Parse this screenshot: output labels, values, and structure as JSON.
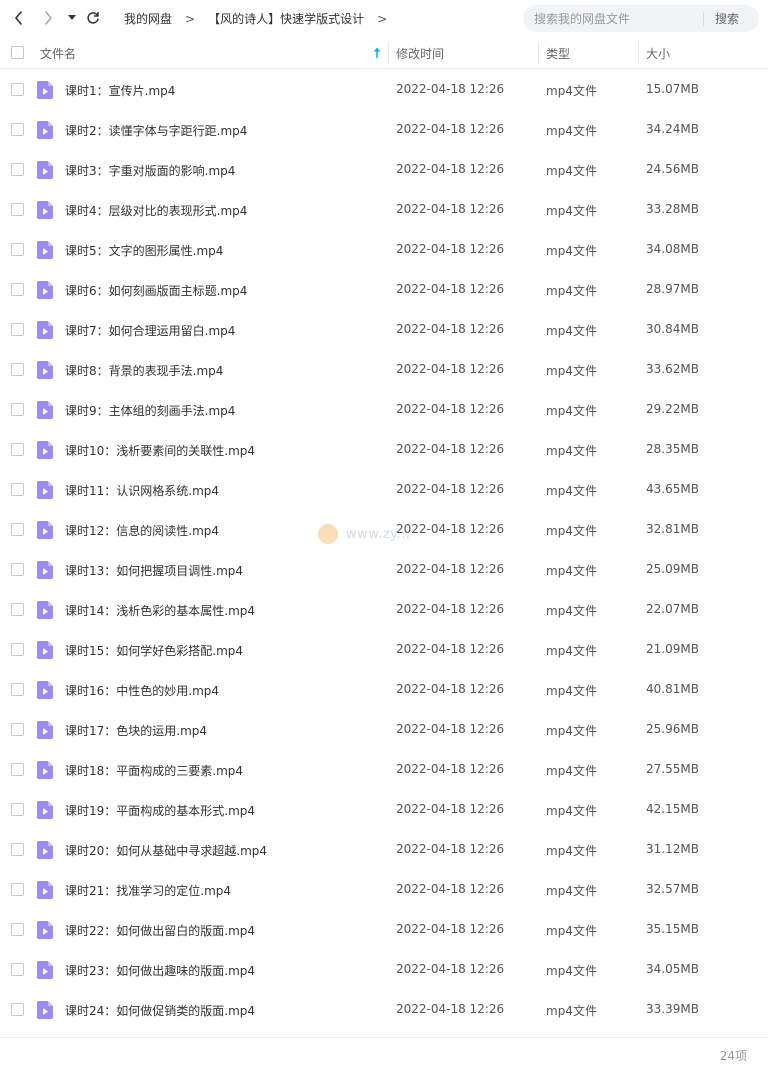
{
  "nav": {
    "back_icon": "chevron-left-icon",
    "forward_icon": "chevron-right-icon",
    "dropdown_icon": "caret-down-icon",
    "refresh_icon": "refresh-icon"
  },
  "breadcrumb": {
    "items": [
      "我的网盘",
      "【风的诗人】快速学版式设计"
    ],
    "separator": ">"
  },
  "search": {
    "placeholder": "搜索我的网盘文件",
    "button_label": "搜索"
  },
  "table": {
    "headers": {
      "name": "文件名",
      "modified": "修改时间",
      "type": "类型",
      "size": "大小"
    },
    "sort_indicator": "sort-ascending-icon",
    "rows": [
      {
        "name": "课时1：宣传片.mp4",
        "modified": "2022-04-18 12:26",
        "type": "mp4文件",
        "size": "15.07MB"
      },
      {
        "name": "课时2：读懂字体与字距行距.mp4",
        "modified": "2022-04-18 12:26",
        "type": "mp4文件",
        "size": "34.24MB"
      },
      {
        "name": "课时3：字重对版面的影响.mp4",
        "modified": "2022-04-18 12:26",
        "type": "mp4文件",
        "size": "24.56MB"
      },
      {
        "name": "课时4：层级对比的表现形式.mp4",
        "modified": "2022-04-18 12:26",
        "type": "mp4文件",
        "size": "33.28MB"
      },
      {
        "name": "课时5：文字的图形属性.mp4",
        "modified": "2022-04-18 12:26",
        "type": "mp4文件",
        "size": "34.08MB"
      },
      {
        "name": "课时6：如何刻画版面主标题.mp4",
        "modified": "2022-04-18 12:26",
        "type": "mp4文件",
        "size": "28.97MB"
      },
      {
        "name": "课时7：如何合理运用留白.mp4",
        "modified": "2022-04-18 12:26",
        "type": "mp4文件",
        "size": "30.84MB"
      },
      {
        "name": "课时8：背景的表现手法.mp4",
        "modified": "2022-04-18 12:26",
        "type": "mp4文件",
        "size": "33.62MB"
      },
      {
        "name": "课时9：主体组的刻画手法.mp4",
        "modified": "2022-04-18 12:26",
        "type": "mp4文件",
        "size": "29.22MB"
      },
      {
        "name": "课时10：浅析要素间的关联性.mp4",
        "modified": "2022-04-18 12:26",
        "type": "mp4文件",
        "size": "28.35MB"
      },
      {
        "name": "课时11：认识网格系统.mp4",
        "modified": "2022-04-18 12:26",
        "type": "mp4文件",
        "size": "43.65MB"
      },
      {
        "name": "课时12：信息的阅读性.mp4",
        "modified": "2022-04-18 12:26",
        "type": "mp4文件",
        "size": "32.81MB"
      },
      {
        "name": "课时13：如何把握项目调性.mp4",
        "modified": "2022-04-18 12:26",
        "type": "mp4文件",
        "size": "25.09MB"
      },
      {
        "name": "课时14：浅析色彩的基本属性.mp4",
        "modified": "2022-04-18 12:26",
        "type": "mp4文件",
        "size": "22.07MB"
      },
      {
        "name": "课时15：如何学好色彩搭配.mp4",
        "modified": "2022-04-18 12:26",
        "type": "mp4文件",
        "size": "21.09MB"
      },
      {
        "name": "课时16：中性色的妙用.mp4",
        "modified": "2022-04-18 12:26",
        "type": "mp4文件",
        "size": "40.81MB"
      },
      {
        "name": "课时17：色块的运用.mp4",
        "modified": "2022-04-18 12:26",
        "type": "mp4文件",
        "size": "25.96MB"
      },
      {
        "name": "课时18：平面构成的三要素.mp4",
        "modified": "2022-04-18 12:26",
        "type": "mp4文件",
        "size": "27.55MB"
      },
      {
        "name": "课时19：平面构成的基本形式.mp4",
        "modified": "2022-04-18 12:26",
        "type": "mp4文件",
        "size": "42.15MB"
      },
      {
        "name": "课时20：如何从基础中寻求超越.mp4",
        "modified": "2022-04-18 12:26",
        "type": "mp4文件",
        "size": "31.12MB"
      },
      {
        "name": "课时21：找准学习的定位.mp4",
        "modified": "2022-04-18 12:26",
        "type": "mp4文件",
        "size": "32.57MB"
      },
      {
        "name": "课时22：如何做出留白的版面.mp4",
        "modified": "2022-04-18 12:26",
        "type": "mp4文件",
        "size": "35.15MB"
      },
      {
        "name": "课时23：如何做出趣味的版面.mp4",
        "modified": "2022-04-18 12:26",
        "type": "mp4文件",
        "size": "34.05MB"
      },
      {
        "name": "课时24：如何做促销类的版面.mp4",
        "modified": "2022-04-18 12:26",
        "type": "mp4文件",
        "size": "33.39MB"
      }
    ]
  },
  "footer": {
    "count": "24项"
  },
  "watermark": {
    "text": "www.zy..."
  },
  "colors": {
    "file_icon": "#9b8cf2",
    "file_icon_fold": "#c8bff8",
    "sort_arrow": "#1aa6ea",
    "search_bg": "#f2f3f5"
  }
}
